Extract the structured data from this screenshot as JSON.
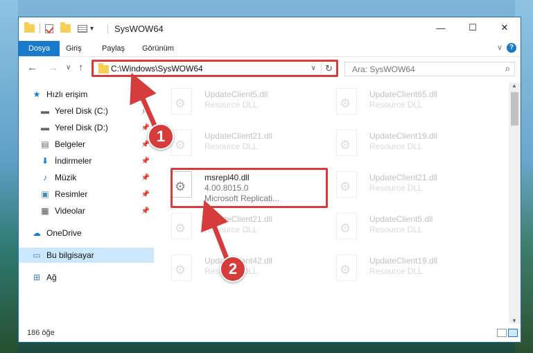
{
  "window": {
    "title": "SysWOW64",
    "controls": {
      "minimize": "—",
      "maximize": "☐",
      "close": "✕"
    }
  },
  "ribbon": {
    "tabs": [
      "Dosya",
      "Giriş",
      "Paylaş",
      "Görünüm"
    ],
    "active_tab": "Dosya",
    "help": "?"
  },
  "navigation": {
    "back": "←",
    "forward": "→",
    "recent": "∨",
    "up": "↑",
    "address": "C:\\Windows\\SysWOW64",
    "search_placeholder": "Ara: SysWOW64"
  },
  "nav_pane": {
    "items": [
      {
        "label": "Hızlı erişim",
        "icon": "star-icon",
        "pinned": false,
        "level": 0
      },
      {
        "label": "Yerel Disk (C:)",
        "icon": "drive-icon",
        "pinned": true,
        "level": 1
      },
      {
        "label": "Yerel Disk (D:)",
        "icon": "drive-icon",
        "pinned": true,
        "level": 1
      },
      {
        "label": "Belgeler",
        "icon": "documents-icon",
        "pinned": true,
        "level": 1
      },
      {
        "label": "İndirmeler",
        "icon": "download-icon",
        "pinned": true,
        "level": 1
      },
      {
        "label": "Müzik",
        "icon": "music-icon",
        "pinned": true,
        "level": 1
      },
      {
        "label": "Resimler",
        "icon": "pictures-icon",
        "pinned": true,
        "level": 1
      },
      {
        "label": "Videolar",
        "icon": "videos-icon",
        "pinned": true,
        "level": 1
      },
      {
        "label": "OneDrive",
        "icon": "cloud-icon",
        "pinned": false,
        "level": 0
      },
      {
        "label": "Bu bilgisayar",
        "icon": "computer-icon",
        "pinned": false,
        "level": 0,
        "selected": true
      },
      {
        "label": "Ağ",
        "icon": "network-icon",
        "pinned": false,
        "level": 0
      }
    ]
  },
  "files": {
    "highlighted": {
      "name": "msrepl40.dll",
      "version": "4.00.8015.0",
      "description": "Microsoft Replicati..."
    },
    "faded": [
      {
        "name": "UpdateClient5.dll",
        "description": "Resource DLL"
      },
      {
        "name": "UpdateClient65.dll",
        "description": "Resource DLL"
      },
      {
        "name": "UpdateClient21.dll",
        "description": "Resource DLL"
      },
      {
        "name": "UpdateClient19.dll",
        "description": "Resource DLL"
      },
      {
        "name": "UpdateClient21.dll",
        "description": "Resource DLL"
      },
      {
        "name": "UpdateClient21.dll",
        "description": "Resource DLL"
      },
      {
        "name": "UpdateClient5.dll",
        "description": "Resource DLL"
      },
      {
        "name": "UpdateClient42.dll",
        "description": "Resource DLL"
      },
      {
        "name": "UpdateClient19.dll",
        "description": "Resource DLL"
      }
    ]
  },
  "status": {
    "item_count": "186 öğe"
  },
  "markers": {
    "one": "1",
    "two": "2"
  },
  "colors": {
    "accent": "#1979ca",
    "highlight": "#d63c3c",
    "selected": "#cce8ff"
  }
}
